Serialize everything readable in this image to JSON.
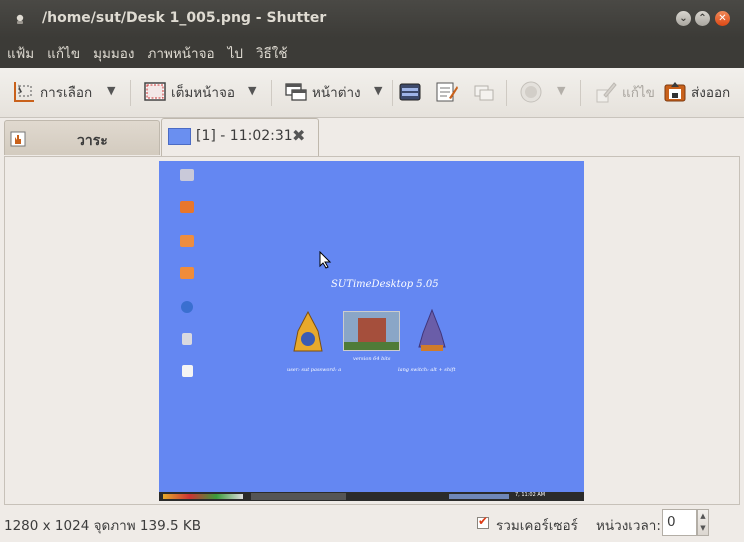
{
  "window": {
    "title": "/home/sut/Desk 1_005.png - Shutter",
    "min_icon": "minimize-icon",
    "max_icon": "maximize-icon",
    "close_icon": "close-icon"
  },
  "menubar": {
    "items": [
      "แฟ้ม",
      "แก้ไข",
      "มุมมอง",
      "ภาพหน้าจอ",
      "ไป",
      "วิธีใช้"
    ]
  },
  "toolbar": {
    "selection_label": "การเลือก",
    "fullscreen_label": "เต็มหน้าจอ",
    "window_label": "หน้าต่าง",
    "edit_label": "แก้ไข",
    "export_label": "ส่งออก",
    "dropdown_arrow": "▼"
  },
  "tabs": {
    "session_label": "วาระ",
    "active_label": "[1] - 11:02:31",
    "close_glyph": "✖"
  },
  "desktop_screenshot": {
    "banner": "SUTimeDesktop 5.05",
    "version": "version 64 bits",
    "user_info": "user: sut password: a",
    "lang_switch": "lang switch: alt + shift",
    "panel_clock": "7, 11:02 AM"
  },
  "status": {
    "resolution": "1280 x 1024 จุดภาพ  139.5 KB",
    "include_cursor_label": "รวมเคอร์เซอร์",
    "include_cursor_checked": true,
    "delay_label": "หน่วงเวลา:",
    "delay_value": "0"
  },
  "colors": {
    "titlebar": "#3c3b37",
    "desktop_blue": "#6487f2",
    "close_orange": "#dd4814"
  }
}
